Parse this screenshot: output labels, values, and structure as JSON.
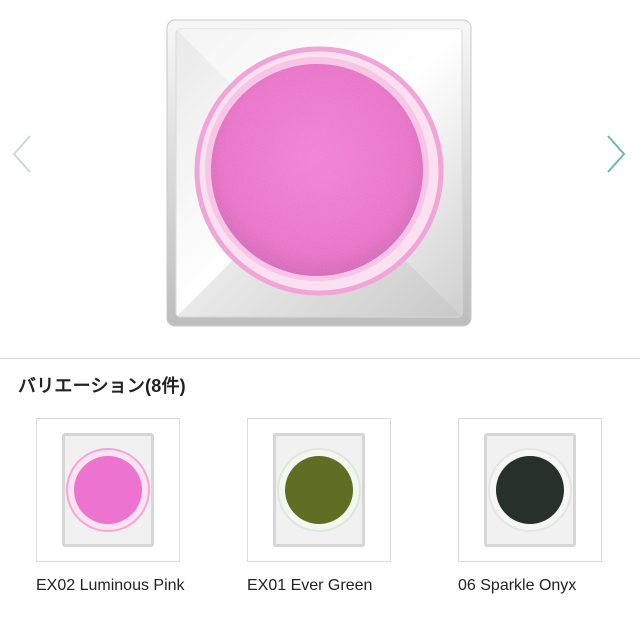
{
  "hero": {
    "product_color": "#e86bc7",
    "rim_color": "#f4a7d6"
  },
  "navigation": {
    "prev_icon": "chevron-left-icon",
    "next_icon": "chevron-right-icon",
    "prev_color": "#cfd8d8",
    "next_color": "#6fb7b2"
  },
  "variations": {
    "title": "バリエーション(8件)",
    "items": [
      {
        "name": "EX02 Luminous Pink",
        "color": "#ec73cf",
        "rim": "#f3a6d8"
      },
      {
        "name": "EX01 Ever Green",
        "color": "#5e6e22",
        "rim": "#e8efe1"
      },
      {
        "name": "06 Sparkle Onyx",
        "color": "#27302a",
        "rim": "#e8ebe8"
      }
    ]
  }
}
